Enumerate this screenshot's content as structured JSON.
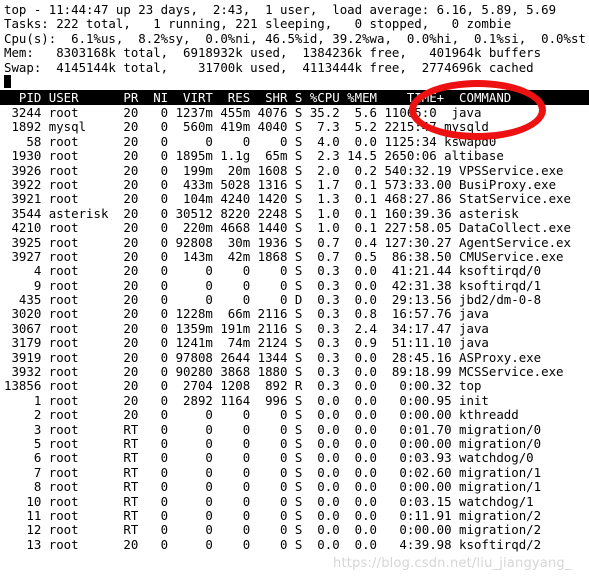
{
  "summary": {
    "uptime_line": "top - 11:44:47 up 23 days,  2:43,  1 user,  load average: 6.16, 5.89, 5.69",
    "tasks_line": "Tasks: 222 total,   1 running, 221 sleeping,   0 stopped,   0 zombie",
    "cpu_line": "Cpu(s):  6.1%us,  8.2%sy,  0.0%ni, 46.5%id, 39.2%wa,  0.0%hi,  0.1%si,  0.0%st",
    "mem_line": "Mem:   8303168k total,  6918932k used,  1384236k free,   401964k buffers",
    "swap_line": "Swap:  4145144k total,    31700k used,  4113444k free,  2774696k cached",
    "fields": {
      "time": "11:44:47",
      "up": "23 days,  2:43",
      "users": "1 user",
      "load_average": "6.16, 5.89, 5.69",
      "tasks_total": "222",
      "tasks_running": "1",
      "tasks_sleeping": "221",
      "tasks_stopped": "0",
      "tasks_zombie": "0",
      "cpu_us": "6.1%",
      "cpu_sy": "8.2%",
      "cpu_ni": "0.0%",
      "cpu_id": "46.5%",
      "cpu_wa": "39.2%",
      "cpu_hi": "0.0%",
      "cpu_si": "0.1%",
      "cpu_st": "0.0%",
      "mem_total": "8303168k",
      "mem_used": "6918932k",
      "mem_free": "1384236k",
      "mem_buffers": "401964k",
      "swap_total": "4145144k",
      "swap_used": "31700k",
      "swap_free": "4113444k",
      "swap_cached": "2774696k"
    }
  },
  "table": {
    "header_line": "  PID USER      PR  NI  VIRT  RES  SHR S %CPU %MEM    TIME+  COMMAND",
    "columns": [
      "PID",
      "USER",
      "PR",
      "NI",
      "VIRT",
      "RES",
      "SHR",
      "S",
      "%CPU",
      "%MEM",
      "TIME+",
      "COMMAND"
    ],
    "rows": [
      " 3244 root      20   0 1237m 455m 4076 S 35.2  5.6 11065:0  java",
      " 1892 mysql     20   0  560m 419m 4040 S  7.3  5.2 2215:47 mysqld",
      "   58 root      20   0     0    0    0 S  4.0  0.0 1125:34 kswapd0",
      " 1930 root      20   0 1895m 1.1g  65m S  2.3 14.5 2650:06 altibase",
      " 3926 root      20   0  199m  20m 1608 S  2.0  0.2 540:32.19 VPSService.exe",
      " 3922 root      20   0  433m 5028 1316 S  1.7  0.1 573:33.00 BusiProxy.exe",
      " 3921 root      20   0  104m 4240 1420 S  1.3  0.1 468:27.86 StatService.exe",
      " 3544 asterisk  20   0 30512 8220 2248 S  1.0  0.1 160:39.36 asterisk",
      " 4210 root      20   0  220m 4668 1440 S  1.0  0.1 227:58.05 DataCollect.exe",
      " 3925 root      20   0 92808  30m 1936 S  0.7  0.4 127:30.27 AgentService.ex",
      " 3927 root      20   0  143m  42m 1868 S  0.7  0.5  86:38.50 CMUService.exe",
      "    4 root      20   0     0    0    0 S  0.3  0.0  41:21.44 ksoftirqd/0",
      "    9 root      20   0     0    0    0 S  0.3  0.0  42:31.38 ksoftirqd/1",
      "  435 root      20   0     0    0    0 D  0.3  0.0  29:13.56 jbd2/dm-0-8",
      " 3020 root      20   0 1228m  66m 2116 S  0.3  0.8  16:57.76 java",
      " 3067 root      20   0 1359m 191m 2116 S  0.3  2.4  34:17.47 java",
      " 3179 root      20   0 1241m  74m 2124 S  0.3  0.9  51:11.10 java",
      " 3919 root      20   0 97808 2644 1344 S  0.3  0.0  28:45.16 ASProxy.exe",
      " 3932 root      20   0 90280 3868 1880 S  0.3  0.0  89:18.99 MCSService.exe",
      "13856 root      20   0  2704 1208  892 R  0.3  0.0   0:00.32 top",
      "    1 root      20   0  2892 1164  996 S  0.0  0.0   0:00.95 init",
      "    2 root      20   0     0    0    0 S  0.0  0.0   0:00.00 kthreadd",
      "    3 root      RT   0     0    0    0 S  0.0  0.0   0:01.70 migration/0",
      "    5 root      RT   0     0    0    0 S  0.0  0.0   0:00.00 migration/0",
      "    6 root      RT   0     0    0    0 S  0.0  0.0   0:03.93 watchdog/0",
      "    7 root      RT   0     0    0    0 S  0.0  0.0   0:02.60 migration/1",
      "    8 root      RT   0     0    0    0 S  0.0  0.0   0:00.00 migration/1",
      "   10 root      RT   0     0    0    0 S  0.0  0.0   0:03.15 watchdog/1",
      "   11 root      RT   0     0    0    0 S  0.0  0.0   0:11.91 migration/2",
      "   12 root      RT   0     0    0    0 S  0.0  0.0   0:00.00 migration/2",
      "   13 root      20   0     0    0    0 S  0.0  0.0   4:39.98 ksoftirqd/2"
    ]
  },
  "annotation": {
    "shape": "ellipse",
    "target": "COMMAND",
    "color": "#ee1111"
  },
  "watermark": {
    "text": "https://blog.csdn.net/liu_jiangyang_"
  }
}
